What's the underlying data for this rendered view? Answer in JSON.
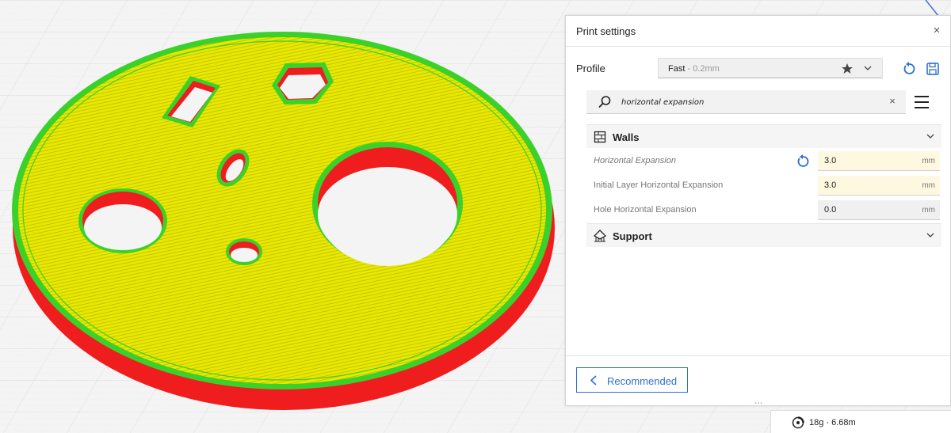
{
  "panel": {
    "title": "Print settings",
    "close_glyph": "×",
    "profile": {
      "label": "Profile",
      "name": "Fast",
      "separator": " - ",
      "layer_height": "0.2mm"
    },
    "search": {
      "value": "horizontal expansion",
      "clear_glyph": "×"
    },
    "categories": [
      {
        "label": "Walls",
        "icon": "walls-icon",
        "settings": [
          {
            "label": "Horizontal Expansion",
            "value": "3.0",
            "unit": "mm"
          },
          {
            "label": "Initial Layer Horizontal Expansion",
            "value": "3.0",
            "unit": "mm"
          },
          {
            "label": "Hole Horizontal Expansion",
            "value": "0.0",
            "unit": "mm"
          }
        ]
      },
      {
        "label": "Support",
        "icon": "support-icon"
      }
    ],
    "recommended_label": "Recommended"
  },
  "estimate": {
    "text": "18g · 6.68m"
  },
  "colors": {
    "accent": "#2f6fd0",
    "user_setting_bg": "#fff8e0",
    "model_top": "#e6e600",
    "model_wall": "#ef1d1d",
    "model_outline": "#3bd12b"
  }
}
